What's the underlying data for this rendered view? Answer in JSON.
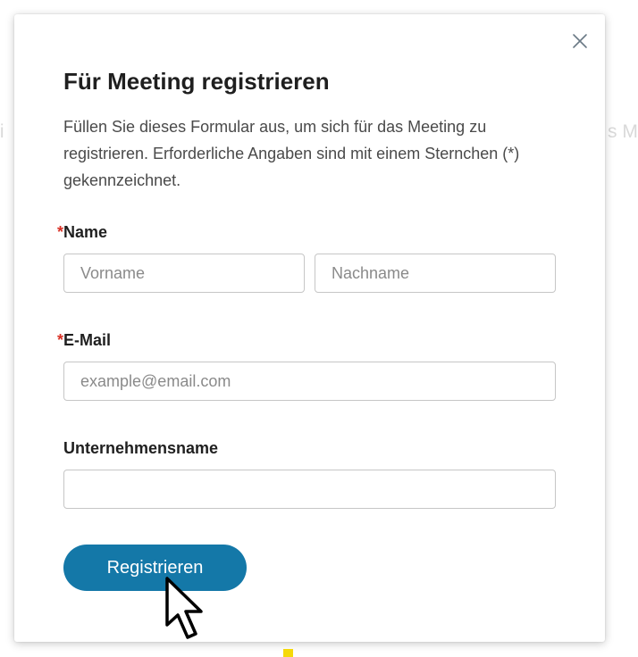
{
  "background": {
    "left_fragment": "ti",
    "right_fragment": "s M"
  },
  "dialog": {
    "close_icon": "close-icon",
    "title": "Für Meeting registrieren",
    "description": "Füllen Sie dieses Formular aus, um sich für das Meeting zu registrieren. Erforderliche Angaben sind mit einem Sternchen (*) gekennzeichnet.",
    "required_marker": "*",
    "name": {
      "label": "Name",
      "required": true,
      "first_placeholder": "Vorname",
      "first_value": "",
      "last_placeholder": "Nachname",
      "last_value": ""
    },
    "email": {
      "label": "E-Mail",
      "required": true,
      "placeholder": "example@email.com",
      "value": ""
    },
    "company": {
      "label": "Unternehmensname",
      "required": false,
      "placeholder": "",
      "value": ""
    },
    "submit_label": "Registrieren"
  },
  "colors": {
    "accent": "#1478a8",
    "required": "#d93025",
    "cursor_highlight": "#f5d90a"
  }
}
